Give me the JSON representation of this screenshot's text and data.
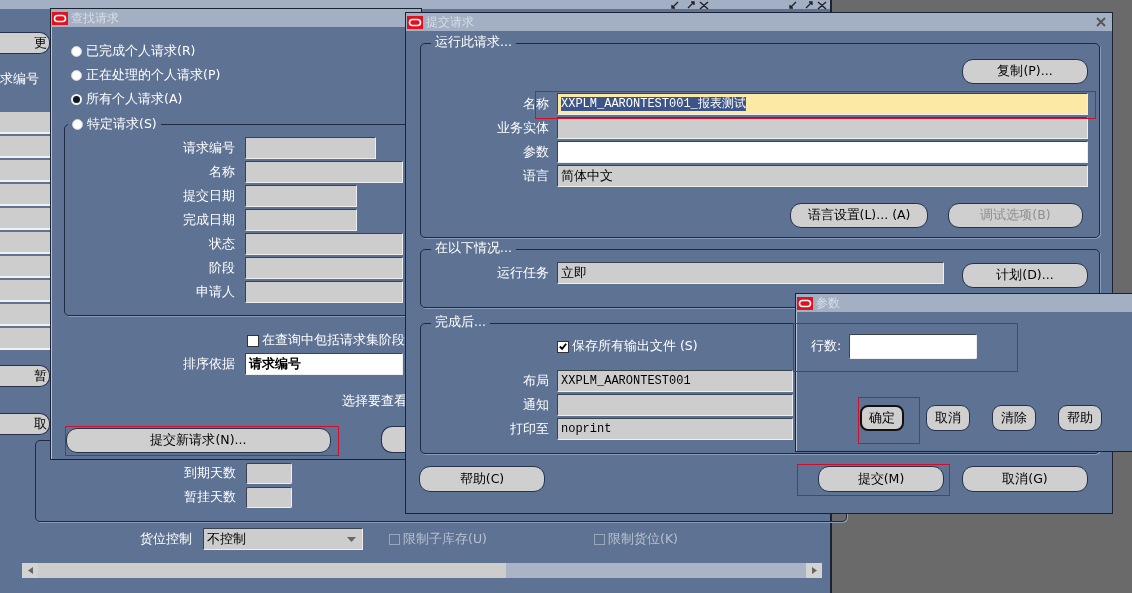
{
  "background_window": {
    "side_buttons": [
      {
        "label": "更"
      },
      {
        "label": "暂"
      },
      {
        "label": "取"
      }
    ],
    "side_label": "求编号",
    "lower_fields": [
      {
        "label": "到期天数"
      },
      {
        "label": "暂挂天数"
      }
    ],
    "locator_control": {
      "label": "货位控制",
      "value": "不控制"
    },
    "checkboxes": [
      {
        "label": "限制子库存(U)",
        "checked": false,
        "disabled": true
      },
      {
        "label": "限制货位(K)",
        "checked": false,
        "disabled": true
      }
    ]
  },
  "find_window": {
    "title": "查找请求",
    "radios": [
      {
        "label": "已完成个人请求(R)",
        "selected": false
      },
      {
        "label": "正在处理的个人请求(P)",
        "selected": false
      },
      {
        "label": "所有个人请求(A)",
        "selected": true
      },
      {
        "label": "特定请求(S)",
        "selected": false
      }
    ],
    "fields": [
      {
        "label": "请求编号",
        "kind": "number"
      },
      {
        "label": "名称",
        "kind": "text"
      },
      {
        "label": "提交日期",
        "kind": "date"
      },
      {
        "label": "完成日期",
        "kind": "date"
      },
      {
        "label": "状态",
        "kind": "text"
      },
      {
        "label": "阶段",
        "kind": "text"
      },
      {
        "label": "申请人",
        "kind": "text"
      }
    ],
    "include_sets": {
      "label": "在查询中包括请求集阶段",
      "checked": false
    },
    "sort_by": {
      "label": "排序依据",
      "value": "请求编号"
    },
    "hint": "选择要查看",
    "submit_button": "提交新请求(N)..."
  },
  "submit_window": {
    "title": "提交请求",
    "run_request": {
      "legend": "运行此请求...",
      "copy_button": "复制(P)...",
      "fields": [
        {
          "label": "名称",
          "kind": "required",
          "value": "XXPLM_AARONTEST001_报表测试",
          "text_selected": true
        },
        {
          "label": "业务实体",
          "kind": "readonly"
        },
        {
          "label": "参数",
          "kind": "editable"
        },
        {
          "label": "语言",
          "kind": "readonly",
          "value": "简体中文"
        }
      ],
      "buttons": [
        {
          "label": "语言设置(L)... (A)",
          "disabled": false
        },
        {
          "label": "调试选项(B)",
          "disabled": true
        }
      ]
    },
    "schedule": {
      "legend": "在以下情况...",
      "field": {
        "label": "运行任务",
        "value": "立即"
      },
      "button": "计划(D)..."
    },
    "completion": {
      "legend": "完成后...",
      "save_output": {
        "label": "保存所有输出文件 (S)",
        "checked": true
      },
      "fields": [
        {
          "label": "布局",
          "value": "XXPLM_AARONTEST001"
        },
        {
          "label": "通知"
        },
        {
          "label": "打印至",
          "value": "noprint"
        }
      ]
    },
    "buttons": [
      {
        "label": "帮助(C)"
      },
      {
        "label": "提交(M)"
      },
      {
        "label": "取消(G)"
      }
    ]
  },
  "parameters_window": {
    "title": "参数",
    "field": {
      "label": "行数:"
    },
    "buttons": [
      {
        "label": "确定",
        "focused": true
      },
      {
        "label": "取消",
        "focused": false
      },
      {
        "label": "清除",
        "focused": false
      },
      {
        "label": "帮助",
        "focused": false
      }
    ]
  }
}
